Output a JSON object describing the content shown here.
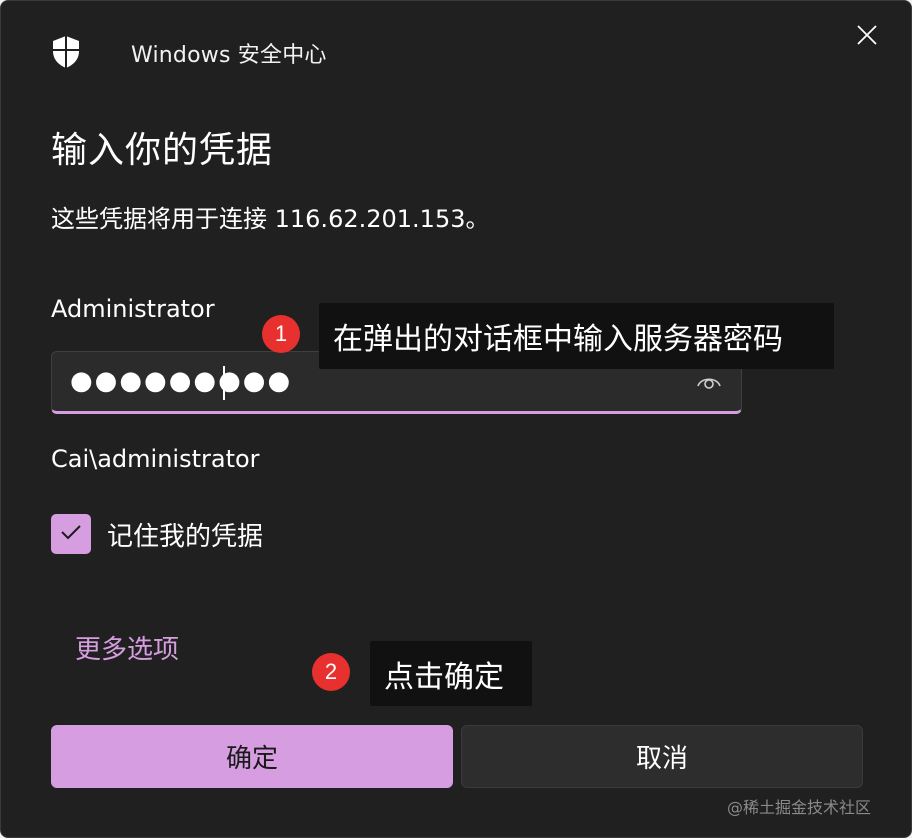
{
  "window": {
    "title": "Windows 安全中心",
    "icon": "shield-icon",
    "close_icon": "close-icon"
  },
  "form": {
    "heading": "输入你的凭据",
    "description": "这些凭据将用于连接 116.62.201.153。",
    "username": "Administrator",
    "password_masked": "●●●●●●●●●",
    "password_reveal_icon": "eye-icon",
    "domain_user": "Cai\\administrator",
    "remember_label": "记住我的凭据",
    "remember_checked": true,
    "more_options": "更多选项"
  },
  "buttons": {
    "ok": "确定",
    "cancel": "取消"
  },
  "annotations": [
    {
      "number": "1",
      "text": "在弹出的对话框中输入服务器密码"
    },
    {
      "number": "2",
      "text": "点击确定"
    }
  ],
  "watermark": "@稀土掘金技术社区",
  "colors": {
    "background": "#202020",
    "accent": "#d69ee0",
    "marker": "#e8302e",
    "callout": "#111111"
  }
}
